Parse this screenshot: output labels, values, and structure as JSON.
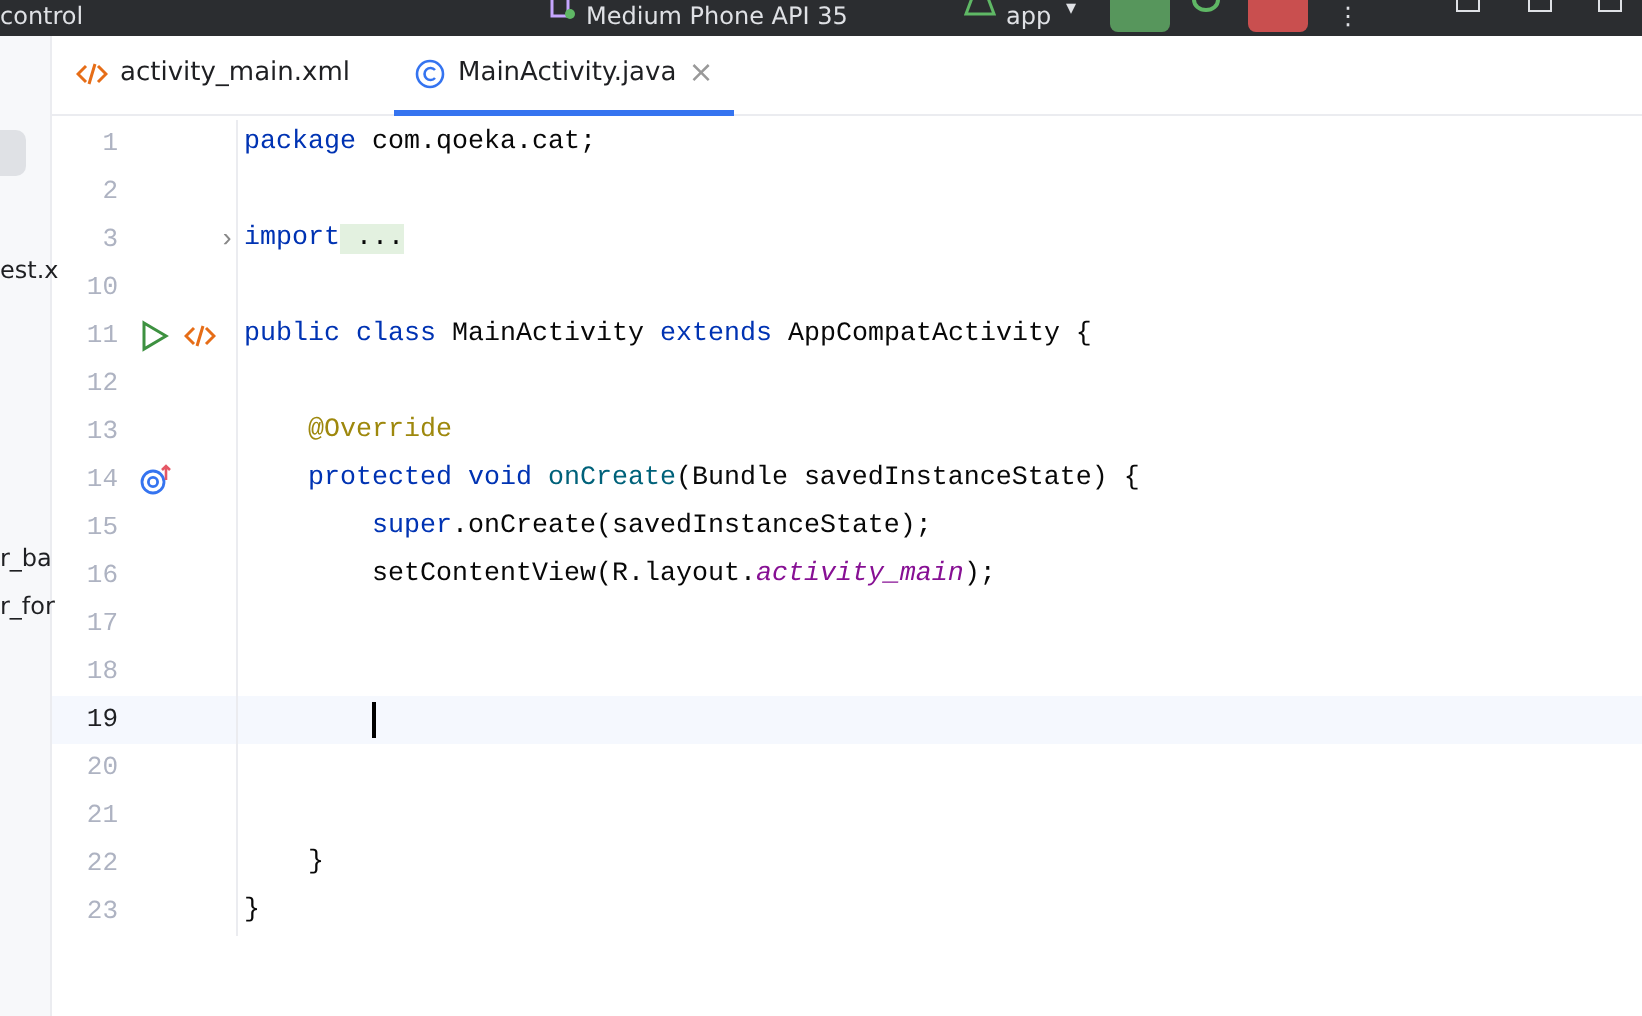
{
  "toolbar": {
    "project": "control",
    "device": "Medium Phone API 35",
    "config": "app",
    "config_caret": "▾",
    "more": "⋮"
  },
  "sidebar": {
    "items": [
      {
        "selected": true
      },
      {
        "label": "est.x",
        "selected": false
      },
      {
        "label": "r_ba",
        "selected": false
      },
      {
        "label": "r_for",
        "selected": false
      }
    ]
  },
  "tabs": [
    {
      "label": "activity_main.xml",
      "kind": "xml",
      "selected": false
    },
    {
      "label": "MainActivity.java",
      "kind": "class",
      "selected": true,
      "close": "×"
    }
  ],
  "editor": {
    "lines": [
      {
        "number": "1",
        "current": false,
        "tokens": [
          {
            "kind": "keyword",
            "text": "package"
          },
          {
            "kind": "plain",
            "text": " com.qoeka.cat;"
          }
        ]
      },
      {
        "number": "2",
        "current": false
      },
      {
        "number": "3",
        "current": false,
        "fold": "›",
        "tokens": [
          {
            "kind": "keyword",
            "text": "import"
          },
          {
            "kind": "folded",
            "text": " ..."
          }
        ]
      },
      {
        "number": "10",
        "current": false
      },
      {
        "number": "11",
        "current": false,
        "gutter": [
          {
            "kind": "run"
          },
          {
            "kind": "xml"
          }
        ],
        "tokens": [
          {
            "kind": "keyword",
            "text": "public class"
          },
          {
            "kind": "plain",
            "text": " MainActivity "
          },
          {
            "kind": "keyword",
            "text": "extends"
          },
          {
            "kind": "plain",
            "text": " AppCompatActivity {"
          }
        ]
      },
      {
        "number": "12",
        "current": false
      },
      {
        "number": "13",
        "current": false,
        "tokens": [
          {
            "kind": "annotation",
            "text": "    @Override"
          }
        ]
      },
      {
        "number": "14",
        "current": false,
        "gutter": [
          {
            "kind": "override"
          }
        ],
        "tokens": [
          {
            "kind": "keyword",
            "text": "    protected void"
          },
          {
            "kind": "method",
            "text": " onCreate"
          },
          {
            "kind": "plain",
            "text": "(Bundle savedInstanceState) {"
          }
        ]
      },
      {
        "number": "15",
        "current": false,
        "tokens": [
          {
            "kind": "keyword",
            "text": "        super"
          },
          {
            "kind": "plain",
            "text": ".onCreate(savedInstanceState);"
          }
        ]
      },
      {
        "number": "16",
        "current": false,
        "tokens": [
          {
            "kind": "plain",
            "text": "        setContentView(R.layout."
          },
          {
            "kind": "field",
            "text": "activity_main"
          },
          {
            "kind": "plain",
            "text": ");"
          }
        ]
      },
      {
        "number": "17",
        "current": false
      },
      {
        "number": "18",
        "current": false
      },
      {
        "number": "19",
        "current": true
      },
      {
        "number": "20",
        "current": false
      },
      {
        "number": "21",
        "current": false
      },
      {
        "number": "22",
        "current": false,
        "tokens": [
          {
            "kind": "plain",
            "text": "    }"
          }
        ]
      },
      {
        "number": "23",
        "current": false,
        "tokens": [
          {
            "kind": "plain",
            "text": "}"
          }
        ]
      }
    ]
  }
}
